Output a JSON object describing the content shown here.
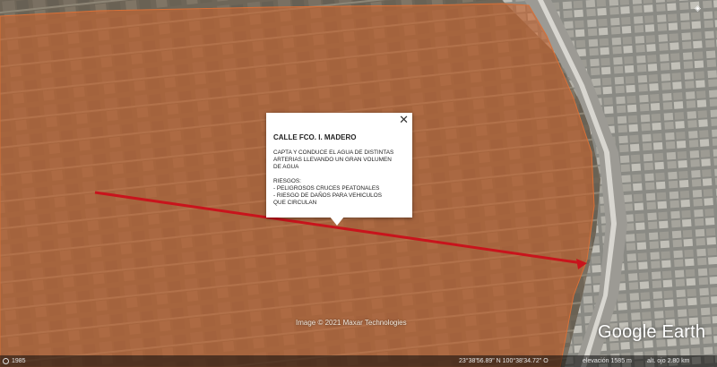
{
  "popup": {
    "close_glyph": "✕",
    "title": "CALLE FCO. I. MADERO",
    "description_lines": [
      "CAPTA Y CONDUCE EL AGUA DE DISTINTAS",
      "ARTERIAS LLEVANDO UN GRAN VOLUMEN",
      "DE AGUA"
    ],
    "risks_label": "RIESGOS:",
    "risk_lines": [
      "- PELIGROSOS CRUCES PEATONALES",
      "- RIESGO DE DAÑOS PARA VEHICULOS",
      "QUE CIRCULAN"
    ]
  },
  "map": {
    "attribution": "Image © 2021 Maxar Technologies",
    "logo_text": "Google Earth",
    "overlay_color": "#c8642e",
    "route_color": "#c8141c",
    "top_right_icon": "compass-icon"
  },
  "status_bar": {
    "year": "1985",
    "coordinates": "23°38'56.89\" N  100°38'34.72\" O",
    "elevation": "elevación  1585 m",
    "eye_altitude": "alt. ojo  2.80 km"
  }
}
